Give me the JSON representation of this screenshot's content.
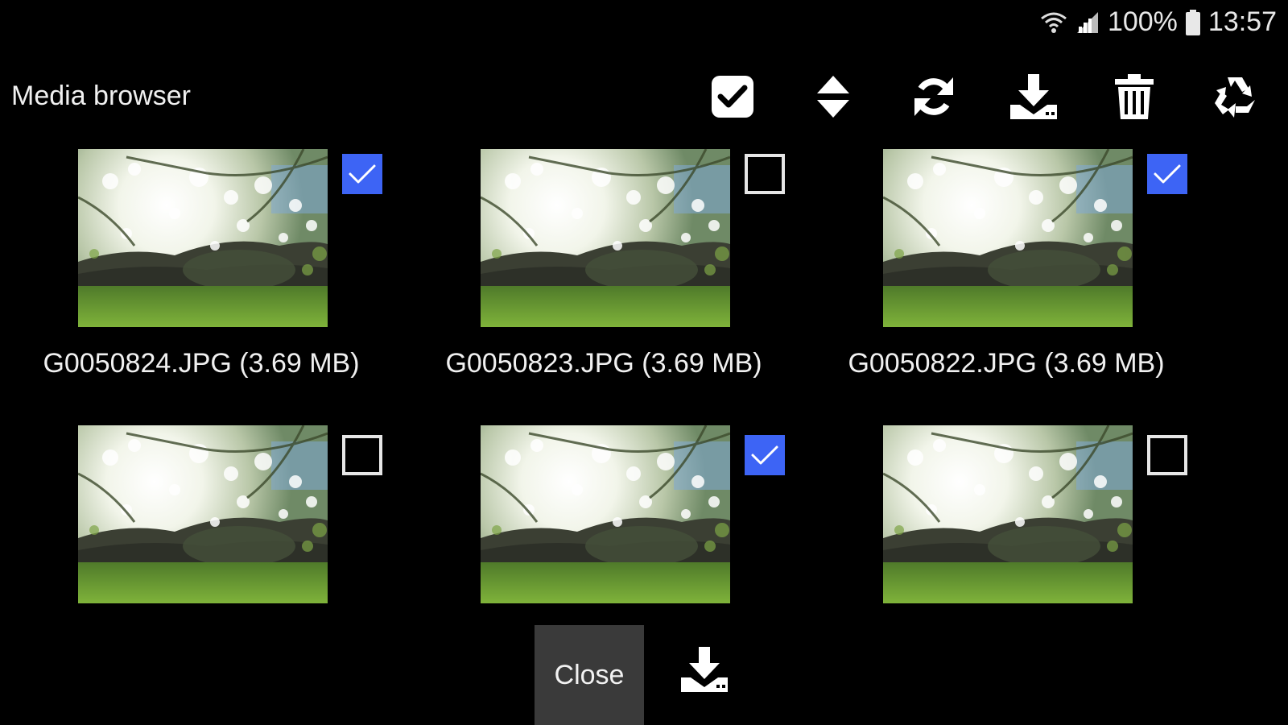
{
  "status_bar": {
    "battery": "100%",
    "time": "13:57",
    "icons": [
      "wifi-icon",
      "signal-icon",
      "battery-icon"
    ]
  },
  "header": {
    "title": "Media browser",
    "toolbar": [
      {
        "name": "select-all-icon",
        "label": "Select all"
      },
      {
        "name": "sort-icon",
        "label": "Sort"
      },
      {
        "name": "refresh-icon",
        "label": "Refresh"
      },
      {
        "name": "download-icon",
        "label": "Download"
      },
      {
        "name": "delete-icon",
        "label": "Delete"
      },
      {
        "name": "recycle-icon",
        "label": "Recycle"
      }
    ]
  },
  "media": [
    {
      "filename": "G0050824.JPG (3.69 MB)",
      "selected": true
    },
    {
      "filename": "G0050823.JPG (3.69 MB)",
      "selected": false
    },
    {
      "filename": "G0050822.JPG (3.69 MB)",
      "selected": true
    },
    {
      "filename": "",
      "selected": false
    },
    {
      "filename": "",
      "selected": true
    },
    {
      "filename": "",
      "selected": false
    }
  ],
  "footer": {
    "close_label": "Close"
  },
  "colors": {
    "background": "#000000",
    "checkbox_selected": "#3d64f5",
    "close_button": "#3a3a3a"
  }
}
